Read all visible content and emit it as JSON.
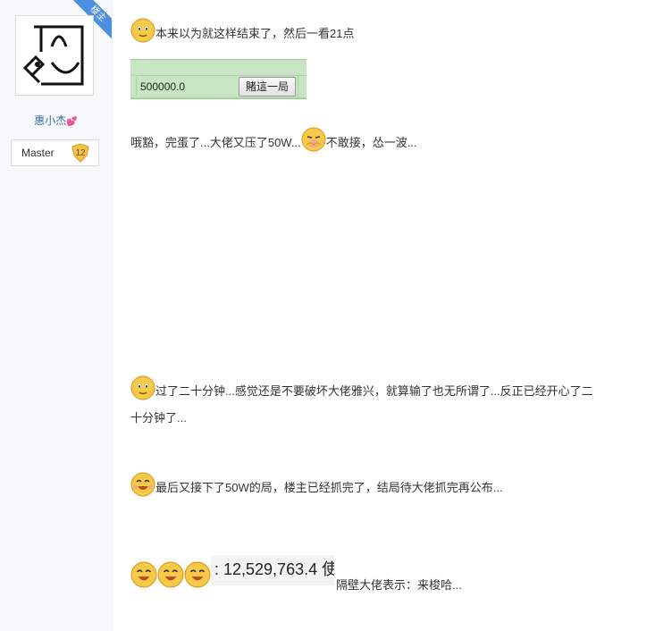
{
  "author": {
    "badge": "楼主",
    "name": "惠小杰",
    "level_name": "Master",
    "level_num": "12"
  },
  "post": {
    "line1": "本来以为就这样结束了，然后一看21点",
    "bet_amount": "500000.0",
    "bet_button": "賭這一局",
    "line2a": "哦豁，完蛋了...大佬又压了50W...",
    "line2b": "不敢接，怂一波...",
    "line3a": "过了二十分钟...感觉还是不要破坏大佬雅兴，就算输了也无所谓了...反正已经开心了二",
    "line3b": "十分钟了...",
    "line4": "最后又接下了50W的局，楼主已经抓完了，结局待大佬抓完再公布...",
    "stats_value": ": 12,529,763.4 使",
    "stats_ghost": "·· ·· ·· ··",
    "line5": "隔壁大佬表示：来梭哈..."
  },
  "colors": {
    "sidebar_bg": "#f7f8fa",
    "badge_blue": "#4b8fe0",
    "username_blue": "#3a6ea5",
    "widget_green": "#c8e4c4",
    "level_gold": "#f2c24a"
  },
  "icons": [
    "smile-emoticon-icon",
    "shy-emoticon-icon",
    "laugh-emoticon-icon",
    "heart-icon",
    "level-shield-icon"
  ]
}
